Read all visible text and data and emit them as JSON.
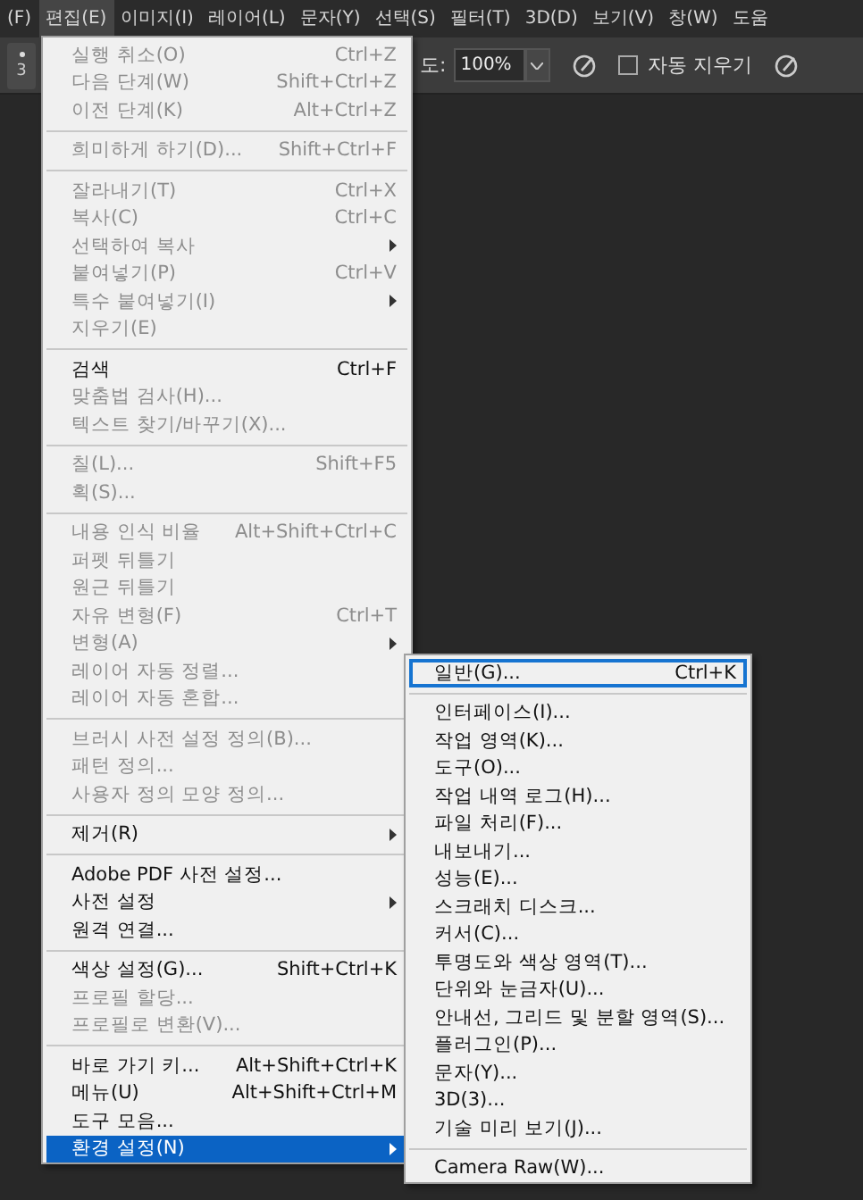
{
  "menubar": [
    {
      "label": "(F)",
      "selected": false
    },
    {
      "label": "편집(E)",
      "selected": true
    },
    {
      "label": "이미지(I)",
      "selected": false
    },
    {
      "label": "레이어(L)",
      "selected": false
    },
    {
      "label": "문자(Y)",
      "selected": false
    },
    {
      "label": "선택(S)",
      "selected": false
    },
    {
      "label": "필터(T)",
      "selected": false
    },
    {
      "label": "3D(D)",
      "selected": false
    },
    {
      "label": "보기(V)",
      "selected": false
    },
    {
      "label": "창(W)",
      "selected": false
    },
    {
      "label": "도움",
      "selected": false
    }
  ],
  "options_bar": {
    "brush_size": "3",
    "opacity_label": "도:",
    "opacity_value": "100%",
    "auto_erase": {
      "label": "자동 지우기",
      "checked": false
    }
  },
  "edit_menu": [
    {
      "kind": "item",
      "label": "실행 취소(O)",
      "shortcut": "Ctrl+Z",
      "disabled": true,
      "submenu": false,
      "selected": false
    },
    {
      "kind": "item",
      "label": "다음 단계(W)",
      "shortcut": "Shift+Ctrl+Z",
      "disabled": true,
      "submenu": false,
      "selected": false
    },
    {
      "kind": "item",
      "label": "이전 단계(K)",
      "shortcut": "Alt+Ctrl+Z",
      "disabled": true,
      "submenu": false,
      "selected": false
    },
    {
      "kind": "separator"
    },
    {
      "kind": "item",
      "label": "희미하게 하기(D)...",
      "shortcut": "Shift+Ctrl+F",
      "disabled": true,
      "submenu": false,
      "selected": false
    },
    {
      "kind": "separator"
    },
    {
      "kind": "item",
      "label": "잘라내기(T)",
      "shortcut": "Ctrl+X",
      "disabled": true,
      "submenu": false,
      "selected": false
    },
    {
      "kind": "item",
      "label": "복사(C)",
      "shortcut": "Ctrl+C",
      "disabled": true,
      "submenu": false,
      "selected": false
    },
    {
      "kind": "item",
      "label": "선택하여 복사",
      "disabled": true,
      "submenu": true,
      "selected": false
    },
    {
      "kind": "item",
      "label": "붙여넣기(P)",
      "shortcut": "Ctrl+V",
      "disabled": true,
      "submenu": false,
      "selected": false
    },
    {
      "kind": "item",
      "label": "특수 붙여넣기(I)",
      "disabled": true,
      "submenu": true,
      "selected": false
    },
    {
      "kind": "item",
      "label": "지우기(E)",
      "disabled": true,
      "submenu": false,
      "selected": false
    },
    {
      "kind": "separator"
    },
    {
      "kind": "item",
      "label": "검색",
      "shortcut": "Ctrl+F",
      "disabled": false,
      "submenu": false,
      "selected": false
    },
    {
      "kind": "item",
      "label": "맞춤법 검사(H)...",
      "disabled": true,
      "submenu": false,
      "selected": false
    },
    {
      "kind": "item",
      "label": "텍스트 찾기/바꾸기(X)...",
      "disabled": true,
      "submenu": false,
      "selected": false
    },
    {
      "kind": "separator"
    },
    {
      "kind": "item",
      "label": "칠(L)...",
      "shortcut": "Shift+F5",
      "disabled": true,
      "submenu": false,
      "selected": false
    },
    {
      "kind": "item",
      "label": "획(S)...",
      "disabled": true,
      "submenu": false,
      "selected": false
    },
    {
      "kind": "separator"
    },
    {
      "kind": "item",
      "label": "내용 인식 비율",
      "shortcut": "Alt+Shift+Ctrl+C",
      "disabled": true,
      "submenu": false,
      "selected": false
    },
    {
      "kind": "item",
      "label": "퍼펫 뒤틀기",
      "disabled": true,
      "submenu": false,
      "selected": false
    },
    {
      "kind": "item",
      "label": "원근 뒤틀기",
      "disabled": true,
      "submenu": false,
      "selected": false
    },
    {
      "kind": "item",
      "label": "자유 변형(F)",
      "shortcut": "Ctrl+T",
      "disabled": true,
      "submenu": false,
      "selected": false
    },
    {
      "kind": "item",
      "label": "변형(A)",
      "disabled": true,
      "submenu": true,
      "selected": false
    },
    {
      "kind": "item",
      "label": "레이어 자동 정렬...",
      "disabled": true,
      "submenu": false,
      "selected": false
    },
    {
      "kind": "item",
      "label": "레이어 자동 혼합...",
      "disabled": true,
      "submenu": false,
      "selected": false
    },
    {
      "kind": "separator"
    },
    {
      "kind": "item",
      "label": "브러시 사전 설정 정의(B)...",
      "disabled": true,
      "submenu": false,
      "selected": false
    },
    {
      "kind": "item",
      "label": "패턴 정의...",
      "disabled": true,
      "submenu": false,
      "selected": false
    },
    {
      "kind": "item",
      "label": "사용자 정의 모양 정의...",
      "disabled": true,
      "submenu": false,
      "selected": false
    },
    {
      "kind": "separator"
    },
    {
      "kind": "item",
      "label": "제거(R)",
      "disabled": false,
      "submenu": true,
      "selected": false
    },
    {
      "kind": "separator"
    },
    {
      "kind": "item",
      "label": "Adobe PDF 사전 설정...",
      "disabled": false,
      "submenu": false,
      "selected": false
    },
    {
      "kind": "item",
      "label": "사전 설정",
      "disabled": false,
      "submenu": true,
      "selected": false
    },
    {
      "kind": "item",
      "label": "원격 연결...",
      "disabled": false,
      "submenu": false,
      "selected": false
    },
    {
      "kind": "separator"
    },
    {
      "kind": "item",
      "label": "색상 설정(G)...",
      "shortcut": "Shift+Ctrl+K",
      "disabled": false,
      "submenu": false,
      "selected": false
    },
    {
      "kind": "item",
      "label": "프로필 할당...",
      "disabled": true,
      "submenu": false,
      "selected": false
    },
    {
      "kind": "item",
      "label": "프로필로 변환(V)...",
      "disabled": true,
      "submenu": false,
      "selected": false
    },
    {
      "kind": "separator"
    },
    {
      "kind": "item",
      "label": "바로 가기 키...",
      "shortcut": "Alt+Shift+Ctrl+K",
      "disabled": false,
      "submenu": false,
      "selected": false
    },
    {
      "kind": "item",
      "label": "메뉴(U)",
      "shortcut": "Alt+Shift+Ctrl+M",
      "disabled": false,
      "submenu": false,
      "selected": false
    },
    {
      "kind": "item",
      "label": "도구 모음...",
      "disabled": false,
      "submenu": false,
      "selected": false
    },
    {
      "kind": "item",
      "label": "환경 설정(N)",
      "disabled": false,
      "submenu": true,
      "selected": true
    }
  ],
  "preferences_submenu": [
    {
      "kind": "item",
      "label": "일반(G)...",
      "shortcut": "Ctrl+K",
      "selected": true
    },
    {
      "kind": "separator"
    },
    {
      "kind": "item",
      "label": "인터페이스(I)...",
      "selected": false
    },
    {
      "kind": "item",
      "label": "작업 영역(K)...",
      "selected": false
    },
    {
      "kind": "item",
      "label": "도구(O)...",
      "selected": false
    },
    {
      "kind": "item",
      "label": "작업 내역 로그(H)...",
      "selected": false
    },
    {
      "kind": "item",
      "label": "파일 처리(F)...",
      "selected": false
    },
    {
      "kind": "item",
      "label": "내보내기...",
      "selected": false
    },
    {
      "kind": "item",
      "label": "성능(E)...",
      "selected": false
    },
    {
      "kind": "item",
      "label": "스크래치 디스크...",
      "selected": false
    },
    {
      "kind": "item",
      "label": "커서(C)...",
      "selected": false
    },
    {
      "kind": "item",
      "label": "투명도와 색상 영역(T)...",
      "selected": false
    },
    {
      "kind": "item",
      "label": "단위와 눈금자(U)...",
      "selected": false
    },
    {
      "kind": "item",
      "label": "안내선, 그리드 및 분할 영역(S)...",
      "selected": false
    },
    {
      "kind": "item",
      "label": "플러그인(P)...",
      "selected": false
    },
    {
      "kind": "item",
      "label": "문자(Y)...",
      "selected": false
    },
    {
      "kind": "item",
      "label": "3D(3)...",
      "selected": false
    },
    {
      "kind": "item",
      "label": "기술 미리 보기(J)...",
      "selected": false
    },
    {
      "kind": "separator"
    },
    {
      "kind": "item",
      "label": "Camera Raw(W)...",
      "selected": false
    }
  ]
}
